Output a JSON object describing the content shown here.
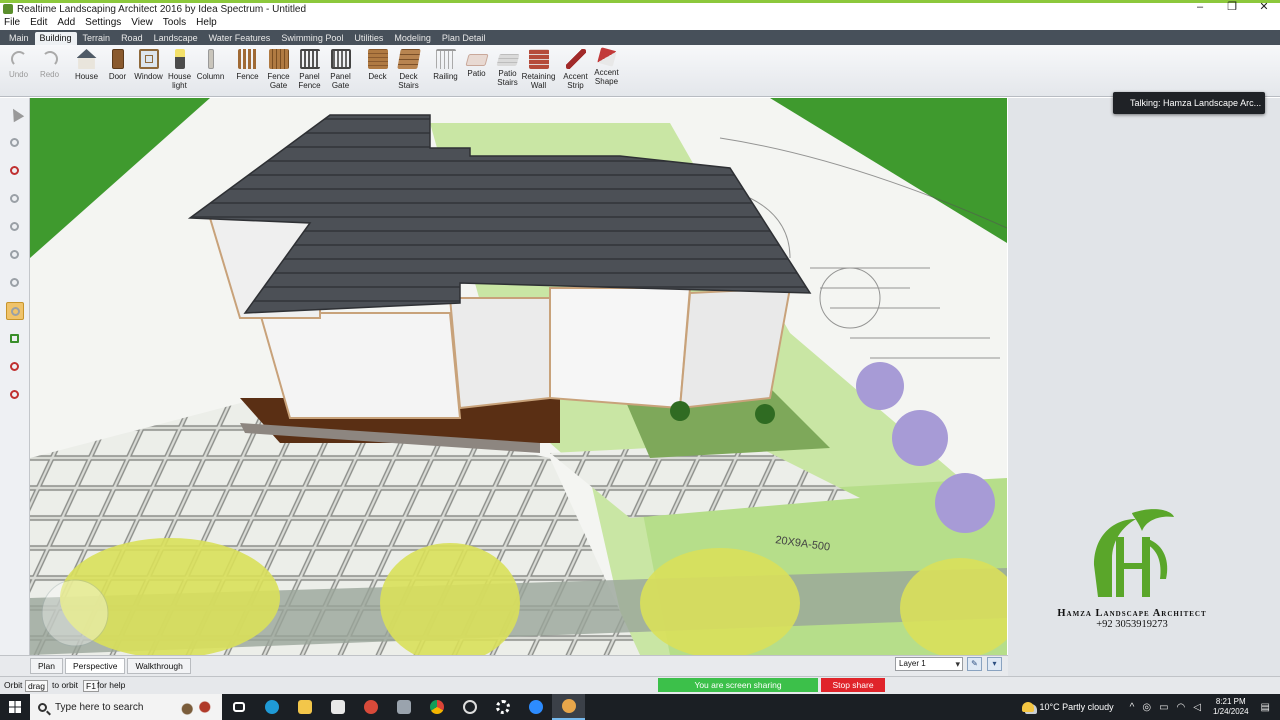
{
  "window": {
    "title": "Realtime Landscaping Architect 2016 by Idea Spectrum - Untitled",
    "controls": [
      "–",
      "❐",
      "✕"
    ]
  },
  "menu": [
    "File",
    "Edit",
    "Add",
    "Settings",
    "View",
    "Tools",
    "Help"
  ],
  "ribbon_tabs": [
    {
      "label": "Main",
      "active": false
    },
    {
      "label": "Building",
      "active": true
    },
    {
      "label": "Terrain",
      "active": false
    },
    {
      "label": "Road",
      "active": false
    },
    {
      "label": "Landscape",
      "active": false
    },
    {
      "label": "Water Features",
      "active": false
    },
    {
      "label": "Swimming Pool",
      "active": false
    },
    {
      "label": "Utilities",
      "active": false
    },
    {
      "label": "Modeling",
      "active": false
    },
    {
      "label": "Plan Detail",
      "active": false
    }
  ],
  "toolbar": {
    "undo": "Undo",
    "redo": "Redo",
    "house": "House",
    "door": "Door",
    "window": "Window",
    "house_light": "House\nlight",
    "column": "Column",
    "fence": "Fence",
    "fence_gate": "Fence\nGate",
    "panel_fence": "Panel\nFence",
    "panel_gate": "Panel\nGate",
    "deck": "Deck",
    "deck_stairs": "Deck\nStairs",
    "railing": "Railing",
    "patio": "Patio",
    "patio_stairs": "Patio\nStairs",
    "retaining_wall": "Retaining\nWall",
    "accent_strip": "Accent\nStrip",
    "accent_shape": "Accent\nShape"
  },
  "viewport": {
    "plan_label": "20X9A-500"
  },
  "notification": {
    "talking": "Talking: Hamza Landscape Arc..."
  },
  "logo": {
    "name": "Hamza Landscape Architect",
    "phone": "+92 3053919273",
    "color": "#5aa62a"
  },
  "view_tabs": [
    {
      "label": "Plan",
      "active": false
    },
    {
      "label": "Perspective",
      "active": true
    },
    {
      "label": "Walkthrough",
      "active": false
    }
  ],
  "layer": {
    "selected": "Layer 1"
  },
  "status": {
    "mode": "Orbit",
    "drag": "drag",
    "drag_hint": "to orbit",
    "key": "F1",
    "key_hint": "for help"
  },
  "screen_share": {
    "sharing": "You are screen sharing",
    "stop": "Stop share"
  },
  "taskbar": {
    "search_placeholder": "Type here to search",
    "weather": "10°C  Partly cloudy",
    "time": "8:21 PM",
    "date": "1/24/2024"
  }
}
